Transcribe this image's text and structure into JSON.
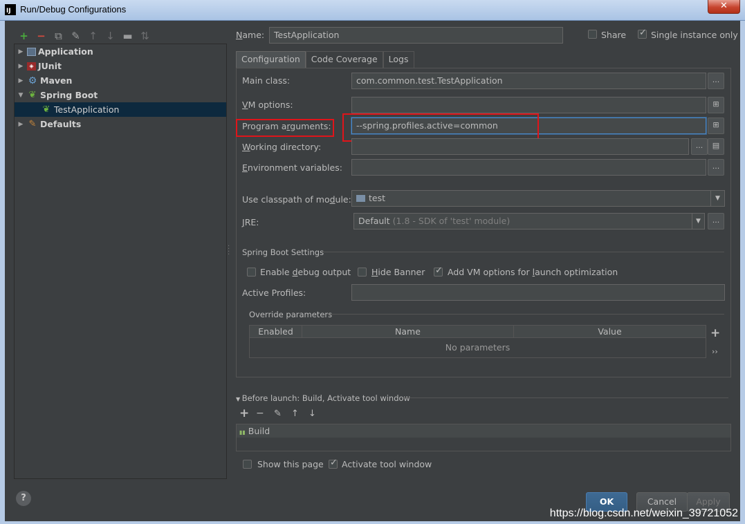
{
  "window": {
    "title": "Run/Debug Configurations",
    "close_glyph": "✕"
  },
  "toolbar": {
    "icons": [
      "add-icon",
      "remove-icon",
      "copy-icon",
      "edit-defaults-icon",
      "move-up-icon",
      "move-down-icon",
      "folder-icon",
      "sort-icon"
    ]
  },
  "tree": {
    "items": [
      {
        "label": "Application",
        "expanded": false,
        "icon": "application-icon"
      },
      {
        "label": "JUnit",
        "expanded": false,
        "icon": "junit-icon"
      },
      {
        "label": "Maven",
        "expanded": false,
        "icon": "maven-icon"
      },
      {
        "label": "Spring Boot",
        "expanded": true,
        "icon": "spring-boot-icon"
      },
      {
        "label": "TestApplication",
        "selected": true,
        "icon": "spring-app-icon"
      },
      {
        "label": "Defaults",
        "expanded": false,
        "icon": "defaults-icon"
      }
    ]
  },
  "header": {
    "name_label": "Name:",
    "name_value": "TestApplication",
    "share_label": "Share",
    "share_checked": false,
    "single_instance_label": "Single instance only",
    "single_instance_checked": true
  },
  "tabs": [
    {
      "label": "Configuration",
      "active": true
    },
    {
      "label": "Code Coverage",
      "active": false
    },
    {
      "label": "Logs",
      "active": false
    }
  ],
  "config": {
    "main_class_label": "Main class:",
    "main_class_value": "com.common.test.TestApplication",
    "vm_options_label": "VM options:",
    "vm_options_value": "",
    "program_args_label": "Program arguments:",
    "program_args_value": "--spring.profiles.active=common",
    "working_dir_label": "Working directory:",
    "working_dir_value": "",
    "env_vars_label": "Environment variables:",
    "env_vars_value": "",
    "classpath_label": "Use classpath of module:",
    "classpath_value": "test",
    "jre_label": "JRE:",
    "jre_value": "Default",
    "jre_detail": "(1.8 - SDK of 'test' module)",
    "ellipsis": "..."
  },
  "spring": {
    "section_title": "Spring Boot Settings",
    "debug_label": "Enable debug output",
    "debug_checked": false,
    "banner_label": "Hide Banner",
    "banner_checked": false,
    "vm_launch_label": "Add VM options for launch optimization",
    "vm_launch_checked": true,
    "profiles_label": "Active Profiles:",
    "profiles_value": "",
    "override_title": "Override parameters",
    "columns": [
      "Enabled",
      "Name",
      "Value"
    ],
    "empty_text": "No parameters"
  },
  "before_launch": {
    "title": "Before launch: Build, Activate tool window",
    "build_label": "Build",
    "show_page_label": "Show this page",
    "show_page_checked": false,
    "activate_label": "Activate tool window",
    "activate_checked": true
  },
  "footer": {
    "ok_label": "OK",
    "cancel_label": "Cancel",
    "apply_label": "Apply",
    "help_glyph": "?"
  },
  "watermark": "https://blog.csdn.net/weixin_39721052",
  "colors": {
    "highlight": "#e0141a",
    "accent": "#4a88c7",
    "selection": "#0d293e"
  }
}
